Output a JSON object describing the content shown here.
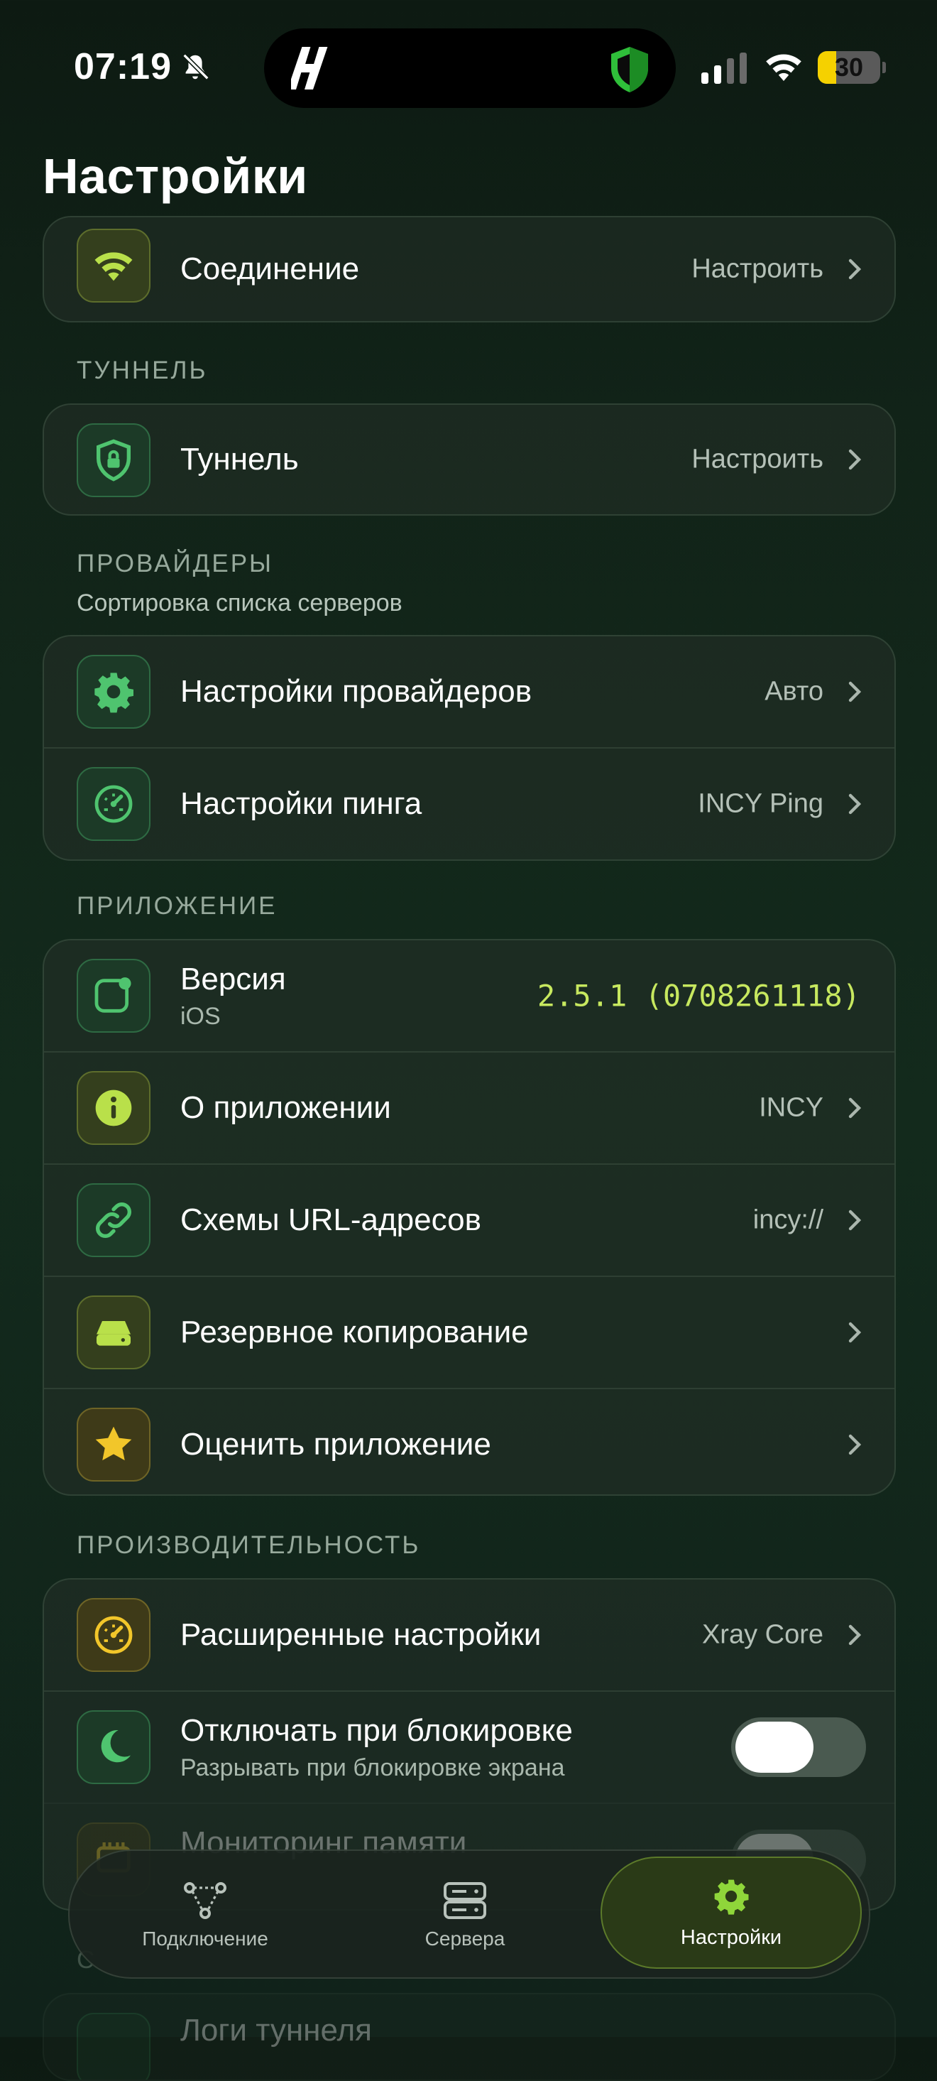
{
  "status_bar": {
    "time": "07:19",
    "battery": "30"
  },
  "page": {
    "title": "Настройки"
  },
  "sections": {
    "top": {
      "connection": {
        "title": "Соединение",
        "value": "Настроить"
      }
    },
    "tunnel": {
      "label": "ТУННЕЛЬ",
      "row": {
        "title": "Туннель",
        "value": "Настроить"
      }
    },
    "providers": {
      "label": "ПРОВАЙДЕРЫ",
      "subtitle": "Сортировка списка серверов",
      "rows": [
        {
          "title": "Настройки провайдеров",
          "value": "Авто"
        },
        {
          "title": "Настройки пинга",
          "value": "INCY Ping"
        }
      ]
    },
    "app": {
      "label": "ПРИЛОЖЕНИЕ",
      "version": {
        "title": "Версия",
        "subtitle": "iOS",
        "value": "2.5.1 (0708261118)"
      },
      "rows": [
        {
          "title": "О приложении",
          "value": "INCY"
        },
        {
          "title": "Схемы URL-адресов",
          "value": "incy://"
        },
        {
          "title": "Резервное копирование",
          "value": ""
        },
        {
          "title": "Оценить приложение",
          "value": ""
        }
      ]
    },
    "performance": {
      "label": "ПРОИЗВОДИТЕЛЬНОСТЬ",
      "advanced": {
        "title": "Расширенные настройки",
        "value": "Xray Core"
      },
      "lock": {
        "title": "Отключать при блокировке",
        "subtitle": "Разрывать при блокировке экрана",
        "enabled": false
      },
      "memory": {
        "title": "Мониторинг памяти",
        "enabled": false
      }
    },
    "logs": {
      "label": "С",
      "row": {
        "title": "Логи туннеля"
      }
    }
  },
  "tab_bar": {
    "tabs": [
      {
        "label": "Подключение",
        "icon": "connection-icon"
      },
      {
        "label": "Сервера",
        "icon": "servers-icon"
      },
      {
        "label": "Настройки",
        "icon": "gear-icon",
        "active": true
      }
    ]
  },
  "colors": {
    "accent": "#8fd63a",
    "value_mono": "#c7e85f",
    "battery": "#f5d100"
  }
}
